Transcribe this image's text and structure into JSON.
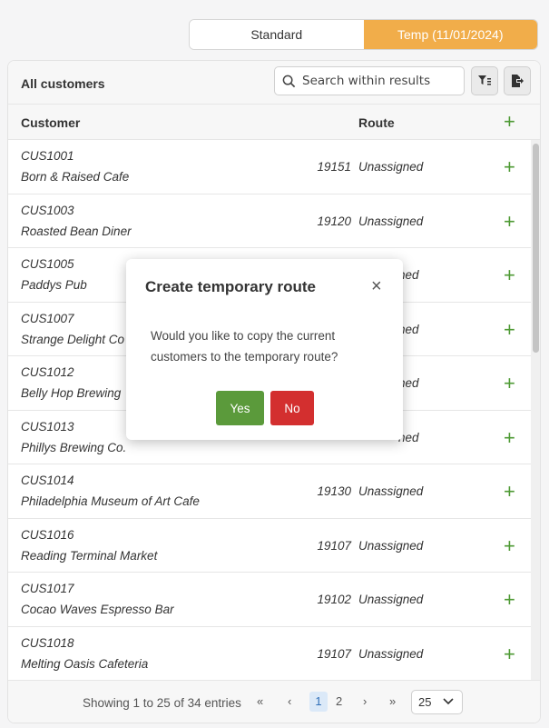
{
  "toggle": {
    "standard": "Standard",
    "temp": "Temp (11/01/2024)"
  },
  "card": {
    "title": "All customers",
    "search_placeholder": "Search within results",
    "filter_icon": "filter-icon",
    "export_icon": "export-icon"
  },
  "columns": {
    "customer": "Customer",
    "route": "Route"
  },
  "rows": [
    {
      "code": "CUS1001",
      "name": "Born & Raised Cafe",
      "zip": "19151",
      "route": "Unassigned"
    },
    {
      "code": "CUS1003",
      "name": "Roasted Bean Diner",
      "zip": "19120",
      "route": "Unassigned"
    },
    {
      "code": "CUS1005",
      "name": "Paddys Pub",
      "zip": "",
      "route": "ned"
    },
    {
      "code": "CUS1007",
      "name": "Strange Delight Co",
      "zip": "",
      "route": "ned"
    },
    {
      "code": "CUS1012",
      "name": "Belly Hop Brewing",
      "zip": "",
      "route": "ned"
    },
    {
      "code": "CUS1013",
      "name": "Phillys Brewing Co.",
      "zip": "",
      "route": "ned"
    },
    {
      "code": "CUS1014",
      "name": "Philadelphia Museum of Art Cafe",
      "zip": "19130",
      "route": "Unassigned"
    },
    {
      "code": "CUS1016",
      "name": "Reading Terminal Market",
      "zip": "19107",
      "route": "Unassigned"
    },
    {
      "code": "CUS1017",
      "name": "Cocao Waves Espresso Bar",
      "zip": "19102",
      "route": "Unassigned"
    },
    {
      "code": "CUS1018",
      "name": "Melting Oasis Cafeteria",
      "zip": "19107",
      "route": "Unassigned"
    }
  ],
  "footer": {
    "info": "Showing 1 to 25 of 34 entries",
    "first": "«",
    "prev": "‹",
    "page1": "1",
    "page2": "2",
    "next": "›",
    "last": "»",
    "page_size": "25"
  },
  "modal": {
    "title": "Create temporary route",
    "close": "×",
    "body": "Would you like to copy the current customers to the temporary route?",
    "yes": "Yes",
    "no": "No"
  },
  "colors": {
    "accent_orange": "#f1ad4a",
    "add_green": "#4e9a34",
    "yes_green": "#5b9a3b",
    "no_red": "#d32f2f"
  }
}
